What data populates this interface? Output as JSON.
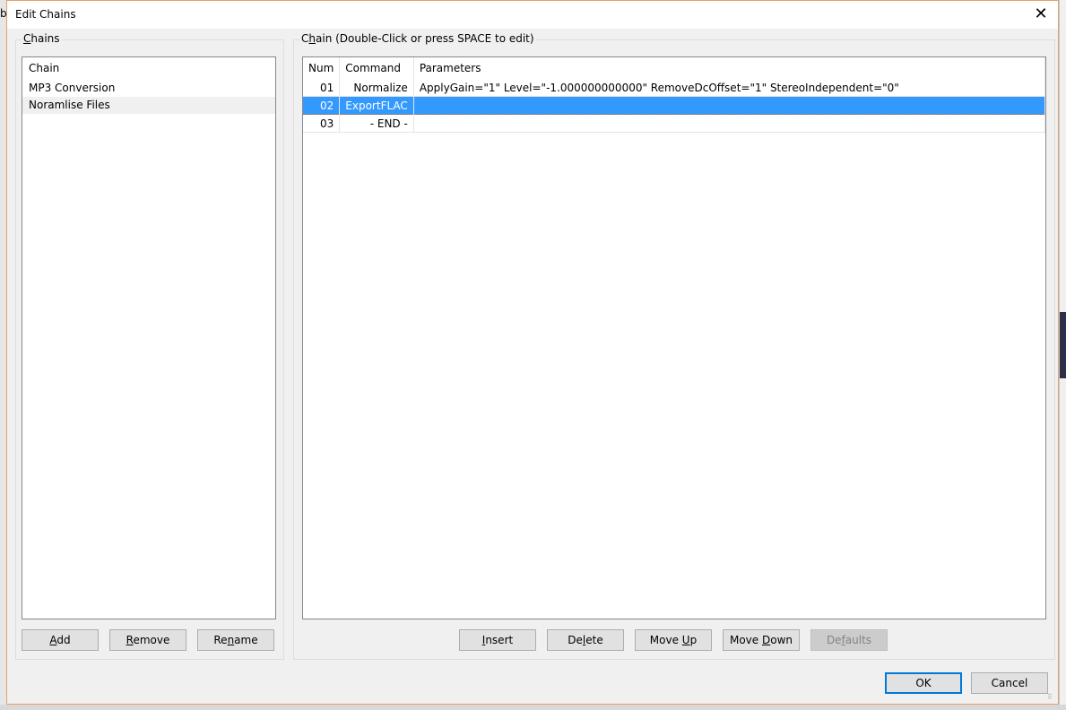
{
  "window": {
    "title": "Edit Chains",
    "close_icon": "close-icon"
  },
  "chains_panel": {
    "group_label": "Chains",
    "mnemonic": "C",
    "list_header": "Chain",
    "items": [
      {
        "label": "MP3 Conversion",
        "selected": false
      },
      {
        "label": "Noramlise Files",
        "selected": true
      }
    ],
    "buttons": [
      {
        "label": "Add",
        "mnemonic": "A"
      },
      {
        "label": "Remove",
        "mnemonic": "R"
      },
      {
        "label": "Rename",
        "mnemonic": "n"
      }
    ]
  },
  "chain_panel": {
    "group_label": "Chain (Double-Click or press SPACE to edit)",
    "columns": [
      "Num",
      "Command",
      "Parameters"
    ],
    "rows": [
      {
        "num": "01",
        "command": "Normalize",
        "parameters": "ApplyGain=\"1\" Level=\"-1.000000000000\" RemoveDcOffset=\"1\" StereoIndependent=\"0\"",
        "selected": false
      },
      {
        "num": "02",
        "command": "ExportFLAC",
        "parameters": "",
        "selected": true
      },
      {
        "num": "03",
        "command": "- END -",
        "parameters": "",
        "selected": false
      }
    ],
    "buttons": [
      {
        "label": "Insert",
        "enabled": true
      },
      {
        "label": "Delete",
        "enabled": true
      },
      {
        "label": "Move Up",
        "enabled": true
      },
      {
        "label": "Move Down",
        "enabled": true
      },
      {
        "label": "Defaults",
        "enabled": false
      }
    ]
  },
  "footer": {
    "ok_label": "OK",
    "cancel_label": "Cancel"
  },
  "colors": {
    "selection": "#3399ff",
    "accent_border": "#e3a16a",
    "default_button_border": "#0078d7"
  }
}
